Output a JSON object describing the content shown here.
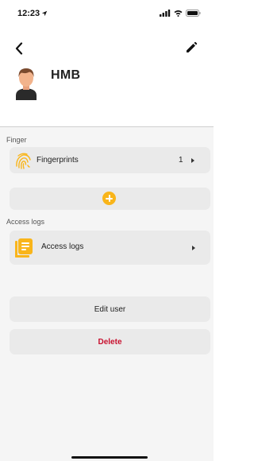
{
  "status_bar": {
    "time": "12:23"
  },
  "user": {
    "name": "HMB"
  },
  "sections": {
    "finger": {
      "label": "Finger",
      "fingerprints": {
        "label": "Fingerprints",
        "count": "1"
      }
    },
    "access_logs": {
      "label": "Access logs",
      "row_label": "Access logs"
    }
  },
  "actions": {
    "edit_label": "Edit user",
    "delete_label": "Delete"
  },
  "colors": {
    "accent": "#f9b51a",
    "danger": "#c8102e",
    "card": "#eaeaea",
    "background": "#f5f5f5"
  },
  "icons": {
    "back": "chevron-left-icon",
    "edit": "pencil-icon",
    "fingerprint": "fingerprint-icon",
    "add": "plus-circle-icon",
    "access_logs": "list-document-icon",
    "chevron": "chevron-right-icon"
  }
}
